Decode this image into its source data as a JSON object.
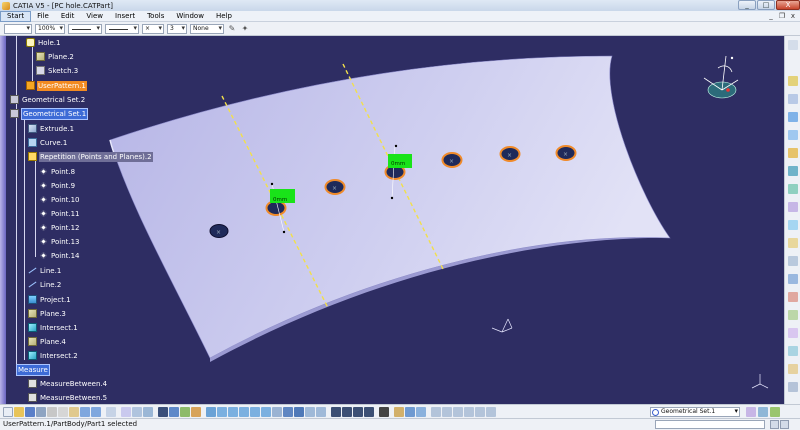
{
  "window": {
    "title": "CATIA V5 - [PC hole.CATPart]",
    "controls": {
      "minimize": "_",
      "maximize": "□",
      "close": "X"
    },
    "mdi_controls": {
      "minimize": "_",
      "restore": "❐",
      "close": "x"
    }
  },
  "menu": {
    "items": [
      "Start",
      "File",
      "Edit",
      "View",
      "Insert",
      "Tools",
      "Window",
      "Help"
    ],
    "active": "Start"
  },
  "format_toolbar": {
    "zoom": "100%",
    "layer": "None",
    "thickness": "3"
  },
  "tree": {
    "nodes": [
      {
        "label": "Hole.1",
        "icon": "hole-icon",
        "depth": 1,
        "state": "normal"
      },
      {
        "label": "Plane.2",
        "icon": "plane-icon",
        "depth": 2,
        "state": "normal"
      },
      {
        "label": "Sketch.3",
        "icon": "sketch-icon",
        "depth": 2,
        "state": "normal"
      },
      {
        "label": "UserPattern.1",
        "icon": "pattern-icon",
        "depth": 1,
        "state": "selected"
      },
      {
        "label": "Geometrical Set.2",
        "icon": "geometrical-set-icon",
        "depth": 0,
        "state": "normal"
      },
      {
        "label": "Geometrical Set.1",
        "icon": "geometrical-set-icon",
        "depth": 0,
        "state": "highlighted"
      },
      {
        "label": "Extrude.1",
        "icon": "extrude-icon",
        "depth": 1,
        "state": "normal"
      },
      {
        "label": "Curve.1",
        "icon": "curve-icon",
        "depth": 1,
        "state": "normal"
      },
      {
        "label": "Repetition (Points and Planes).2",
        "icon": "repetition-icon",
        "depth": 1,
        "state": "preselected"
      },
      {
        "label": "Point.8",
        "icon": "point-icon",
        "depth": 2,
        "state": "normal"
      },
      {
        "label": "Point.9",
        "icon": "point-icon",
        "depth": 2,
        "state": "normal"
      },
      {
        "label": "Point.10",
        "icon": "point-icon",
        "depth": 2,
        "state": "normal"
      },
      {
        "label": "Point.11",
        "icon": "point-icon",
        "depth": 2,
        "state": "normal"
      },
      {
        "label": "Point.12",
        "icon": "point-icon",
        "depth": 2,
        "state": "normal"
      },
      {
        "label": "Point.13",
        "icon": "point-icon",
        "depth": 2,
        "state": "normal"
      },
      {
        "label": "Point.14",
        "icon": "point-icon",
        "depth": 2,
        "state": "normal"
      },
      {
        "label": "Line.1",
        "icon": "line-icon",
        "depth": 1,
        "state": "normal"
      },
      {
        "label": "Line.2",
        "icon": "line-icon",
        "depth": 1,
        "state": "normal"
      },
      {
        "label": "Project.1",
        "icon": "project-icon",
        "depth": 1,
        "state": "normal"
      },
      {
        "label": "Plane.3",
        "icon": "plane-icon",
        "depth": 1,
        "state": "normal"
      },
      {
        "label": "Intersect.1",
        "icon": "intersect-icon",
        "depth": 1,
        "state": "normal"
      },
      {
        "label": "Plane.4",
        "icon": "plane-icon",
        "depth": 1,
        "state": "normal"
      },
      {
        "label": "Intersect.2",
        "icon": "intersect-icon",
        "depth": 1,
        "state": "normal"
      },
      {
        "label": "Measure",
        "icon": "measure-root-icon",
        "depth": 0,
        "state": "highlighted"
      },
      {
        "label": "MeasureBetween.4",
        "icon": "measure-between-icon",
        "depth": 1,
        "state": "normal"
      },
      {
        "label": "MeasureBetween.5",
        "icon": "measure-between-icon",
        "depth": 1,
        "state": "normal"
      }
    ]
  },
  "viewport": {
    "measure_labels": [
      "0mm",
      "0mm"
    ],
    "colors": {
      "background": "#2e2d63",
      "surface": "#c9c9ec",
      "hole_ring": "#f08a2a",
      "hole": "#1f2a5a",
      "measure_tag": "#19e319",
      "guide_line": "#f2e04a"
    }
  },
  "geometry_combo": {
    "value": "Geometrical Set.1"
  },
  "status": {
    "text": "UserPattern.1/PartBody/Part1 selected"
  }
}
